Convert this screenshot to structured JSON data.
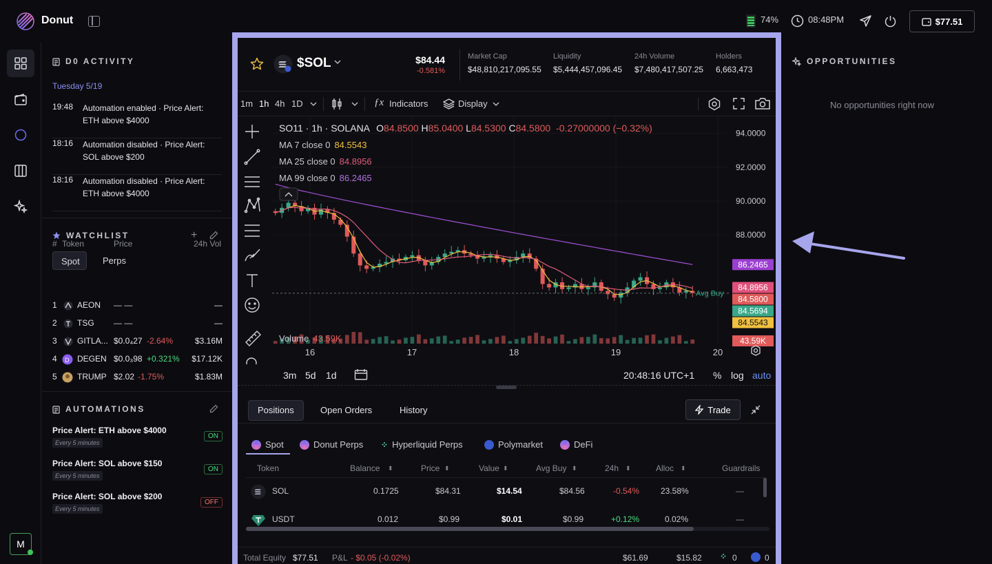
{
  "app": {
    "name": "Donut",
    "battery": "74%",
    "time": "08:48PM",
    "wallet": "$77.51"
  },
  "activity": {
    "title": "D0 ACTIVITY",
    "date": "Tuesday 5/19",
    "items": [
      {
        "time": "19:48",
        "text": "Automation enabled · Price Alert: ETH above $4000"
      },
      {
        "time": "18:16",
        "text": "Automation disabled · Price Alert: SOL above $200"
      },
      {
        "time": "18:16",
        "text": "Automation disabled · Price Alert: ETH above $4000"
      }
    ]
  },
  "watchlist": {
    "title": "WATCHLIST",
    "tabs": [
      "Spot",
      "Perps"
    ],
    "headers": [
      "#",
      "Token",
      "Price",
      "24h Vol"
    ],
    "rows": [
      {
        "n": "1",
        "token": "AEON",
        "price": "— —",
        "chg": "",
        "vol": "—"
      },
      {
        "n": "2",
        "token": "TSG",
        "price": "— —",
        "chg": "",
        "vol": "—"
      },
      {
        "n": "3",
        "token": "GITLA...",
        "price": "$0.0₄27",
        "chg": "-2.64%",
        "vol": "$3.16M"
      },
      {
        "n": "4",
        "token": "DEGEN",
        "price": "$0.0₃98",
        "chg": "+0.321%",
        "vol": "$17.12K"
      },
      {
        "n": "5",
        "token": "TRUMP",
        "price": "$2.02",
        "chg": "-1.75%",
        "vol": "$1.83M"
      }
    ]
  },
  "automations": {
    "title": "AUTOMATIONS",
    "items": [
      {
        "name": "Price Alert: ETH above $4000",
        "freq": "Every 5 minutes",
        "state": "ON"
      },
      {
        "name": "Price Alert: SOL above $150",
        "freq": "Every 5 minutes",
        "state": "ON"
      },
      {
        "name": "Price Alert: SOL above $200",
        "freq": "Every 5 minutes",
        "state": "OFF"
      }
    ]
  },
  "avatar": "M",
  "token": {
    "symbol": "$SOL",
    "price": "$84.44",
    "change": "-0.581%",
    "stats": [
      {
        "label": "Market Cap",
        "value": "$48,810,217,095.55"
      },
      {
        "label": "Liquidity",
        "value": "$5,444,457,096.45"
      },
      {
        "label": "24h Volume",
        "value": "$7,480,417,507.25"
      },
      {
        "label": "Holders",
        "value": "6,663,473"
      }
    ]
  },
  "toolbar": {
    "intervals": [
      "1m",
      "1h",
      "4h",
      "1D"
    ],
    "indicators": "Indicators",
    "display": "Display"
  },
  "chart_data": {
    "type": "candlestick",
    "title": "SO11 · 1h · SOLANA",
    "ohlc": {
      "o": "84.8500",
      "h": "85.0400",
      "l": "84.5300",
      "c": "84.5800",
      "chg": "-0.27000000 (−0.32%)"
    },
    "ma": [
      {
        "name": "MA 7 close 0",
        "value": "84.5543",
        "color": "#f0c040"
      },
      {
        "name": "MA 25 close 0",
        "value": "84.8956",
        "color": "#e05a7a"
      },
      {
        "name": "MA 99 close 0",
        "value": "86.2465",
        "color": "#a050d8"
      }
    ],
    "y_ticks": [
      "94.0000",
      "92.0000",
      "90.0000",
      "88.0000"
    ],
    "y_range": [
      82.8,
      95
    ],
    "x_ticks": [
      "16",
      "17",
      "18",
      "19",
      "20"
    ],
    "price_tags": [
      {
        "label": "86.2465",
        "value": 86.2465,
        "color": "#9b3fd0"
      },
      {
        "label": "84.8956",
        "value": 84.8956,
        "color": "#e0507a"
      },
      {
        "label": "84.5800",
        "value": 84.58,
        "color": "#e05a5a"
      },
      {
        "label": "84.5694",
        "value": 84.5694,
        "color": "#3aa88a"
      },
      {
        "label": "84.5543",
        "value": 84.5543,
        "color": "#f0c040"
      }
    ],
    "avg_buy": {
      "label": "Avg Buy",
      "value": 84.56
    },
    "volume": {
      "label": "Volume",
      "value": "43.59K"
    },
    "closes": [
      89.3,
      89.6,
      89.9,
      89.7,
      89.4,
      89.6,
      89.2,
      89.5,
      89.3,
      88.9,
      88.6,
      87.9,
      86.9,
      86.2,
      86.0,
      86.1,
      86.3,
      86.4,
      86.6,
      86.5,
      86.7,
      86.8,
      86.5,
      86.2,
      86.4,
      86.7,
      86.9,
      87.0,
      87.1,
      86.9,
      86.8,
      86.6,
      86.7,
      86.8,
      86.6,
      86.4,
      86.5,
      86.7,
      86.9,
      86.6,
      86.0,
      85.1,
      84.9,
      85.2,
      84.8,
      84.9,
      85.1,
      84.8,
      84.9,
      85.2,
      84.7,
      84.5,
      84.3,
      84.6,
      84.9,
      85.3,
      85.5,
      85.1,
      84.8,
      84.9,
      85.2,
      84.9,
      84.6,
      84.7,
      84.58
    ]
  },
  "timeframes": {
    "ranges": [
      "3m",
      "5d",
      "1d"
    ],
    "clock": "20:48:16 UTC+1",
    "pct": "%",
    "log": "log",
    "auto": "auto"
  },
  "positions": {
    "tabs": [
      "Positions",
      "Open Orders",
      "History"
    ],
    "trade": "Trade",
    "subtabs": [
      "Spot",
      "Donut Perps",
      "Hyperliquid Perps",
      "Polymarket",
      "DeFi"
    ],
    "headers": [
      "Token",
      "Balance",
      "Price",
      "Value",
      "Avg Buy",
      "24h",
      "Alloc",
      "Guardrails"
    ],
    "rows": [
      {
        "token": "SOL",
        "balance": "0.1725",
        "price": "$84.31",
        "value": "$14.54",
        "avg": "$84.56",
        "chg": "-0.54%",
        "alloc": "23.58%",
        "guard": "—"
      },
      {
        "token": "USDT",
        "balance": "0.012",
        "price": "$0.99",
        "value": "$0.01",
        "avg": "$0.99",
        "chg": "+0.12%",
        "alloc": "0.02%",
        "guard": "—"
      }
    ]
  },
  "footer": {
    "equity_label": "Total Equity",
    "equity": "$77.51",
    "pnl_label": "P&L",
    "pnl": "- $0.05 (-0.02%)",
    "b1": "$61.69",
    "b2": "$15.82",
    "b3": "0",
    "b4": "0"
  },
  "opportunities": {
    "title": "OPPORTUNITIES",
    "empty": "No opportunities right now"
  },
  "colors": {
    "accent": "#a7a5ec",
    "up": "#3aa88a",
    "down": "#e05a5a"
  }
}
